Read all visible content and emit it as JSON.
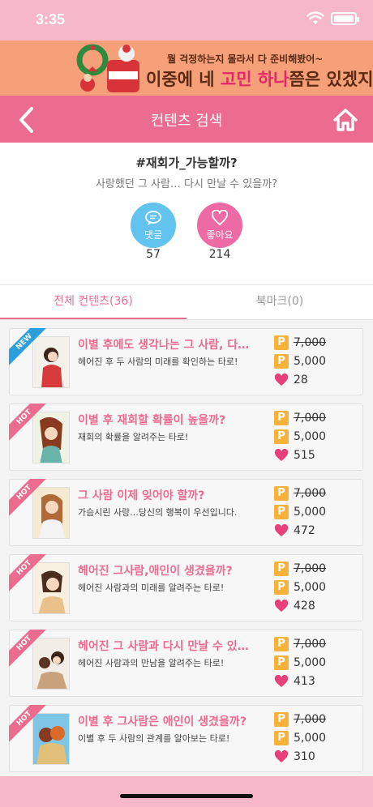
{
  "status": {
    "time": "3:35"
  },
  "banner": {
    "line1": "뭘 걱정하는지 몰라서 다 준비해봤어~",
    "line2_pre": "이중에 네 ",
    "line2_hl1": "고민",
    "line2_mid": " ",
    "line2_hl2": "하나",
    "line2_post": "쯤은 있겠지!"
  },
  "nav": {
    "title": "컨텐츠 검색",
    "back_icon": "chevron-left-icon",
    "home_icon": "home-icon"
  },
  "header": {
    "hashtag": "#재회가_가능할까?",
    "subtitle": "사랑했던 그 사람… 다시 만날 수 있을까?",
    "comment_label": "댓글",
    "comment_count": "57",
    "like_label": "좋아요",
    "like_count": "214"
  },
  "tabs": {
    "all": "전체 컨텐츠(36)",
    "bookmark": "북마크(0)"
  },
  "items": [
    {
      "badge": "NEW",
      "title": "이별 후에도 생각나는 그 사람, 다시…",
      "desc": "헤어진 후 두 사람의 미래를 확인하는 타로!",
      "price_orig": "7,000",
      "price_sale": "5,000",
      "likes": "28"
    },
    {
      "badge": "HOT",
      "title": "이별 후 재회할 확률이 높을까?",
      "desc": "재회의 확률을 알려주는 타로!",
      "price_orig": "7,000",
      "price_sale": "5,000",
      "likes": "515"
    },
    {
      "badge": "HOT",
      "title": "그 사람 이제 잊어야 할까?",
      "desc": "가슴시린 사랑...당신의 행복이 우선입니다.",
      "price_orig": "7,000",
      "price_sale": "5,000",
      "likes": "472"
    },
    {
      "badge": "HOT",
      "title": "헤어진 그사람,애인이 생겼을까?",
      "desc": "헤어진 사람과의 미래를 알려주는 타로!",
      "price_orig": "7,000",
      "price_sale": "5,000",
      "likes": "428"
    },
    {
      "badge": "HOT",
      "title": "헤어진 그 사람과 다시 만날 수 있을…",
      "desc": "헤어진 사람과의 만남을 알려주는 타로!",
      "price_orig": "7,000",
      "price_sale": "5,000",
      "likes": "413"
    },
    {
      "badge": "HOT",
      "title": "이별 후 그사람은 애인이 생겼을까?",
      "desc": "이별 후 두 사람의 관계를 알아보는 타로!",
      "price_orig": "7,000",
      "price_sale": "5,000",
      "likes": "310"
    }
  ],
  "colors": {
    "accent": "#ec6c8f",
    "comment": "#62c4ee",
    "like": "#ee6aa4",
    "point": "#f6b23a"
  }
}
